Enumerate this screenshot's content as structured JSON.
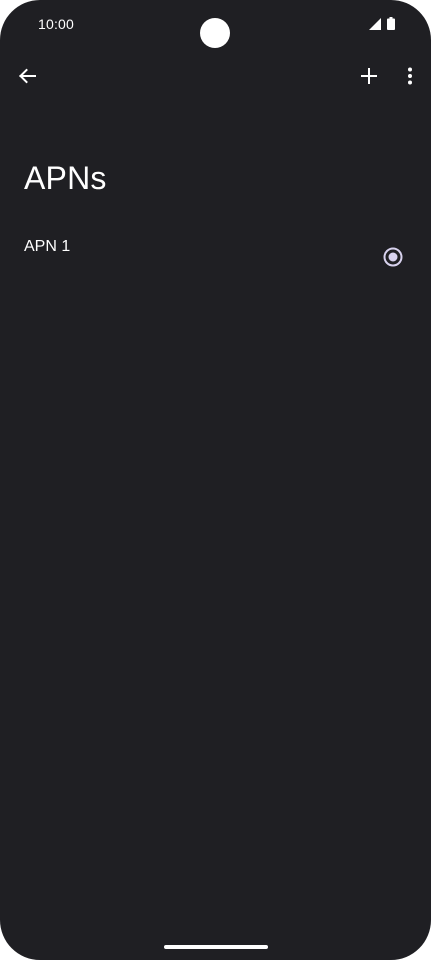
{
  "status_bar": {
    "time": "10:00",
    "icons": [
      "signal-icon",
      "battery-icon"
    ]
  },
  "app_bar": {
    "back_icon": "back-arrow-icon",
    "add_icon": "plus-icon",
    "more_icon": "more-vert-icon"
  },
  "page": {
    "title": "APNs"
  },
  "apns": [
    {
      "name": "APN 1",
      "selected": true
    }
  ],
  "colors": {
    "background": "#1f1f23",
    "text": "#ffffff",
    "radio_accent": "#d8d2ee"
  }
}
